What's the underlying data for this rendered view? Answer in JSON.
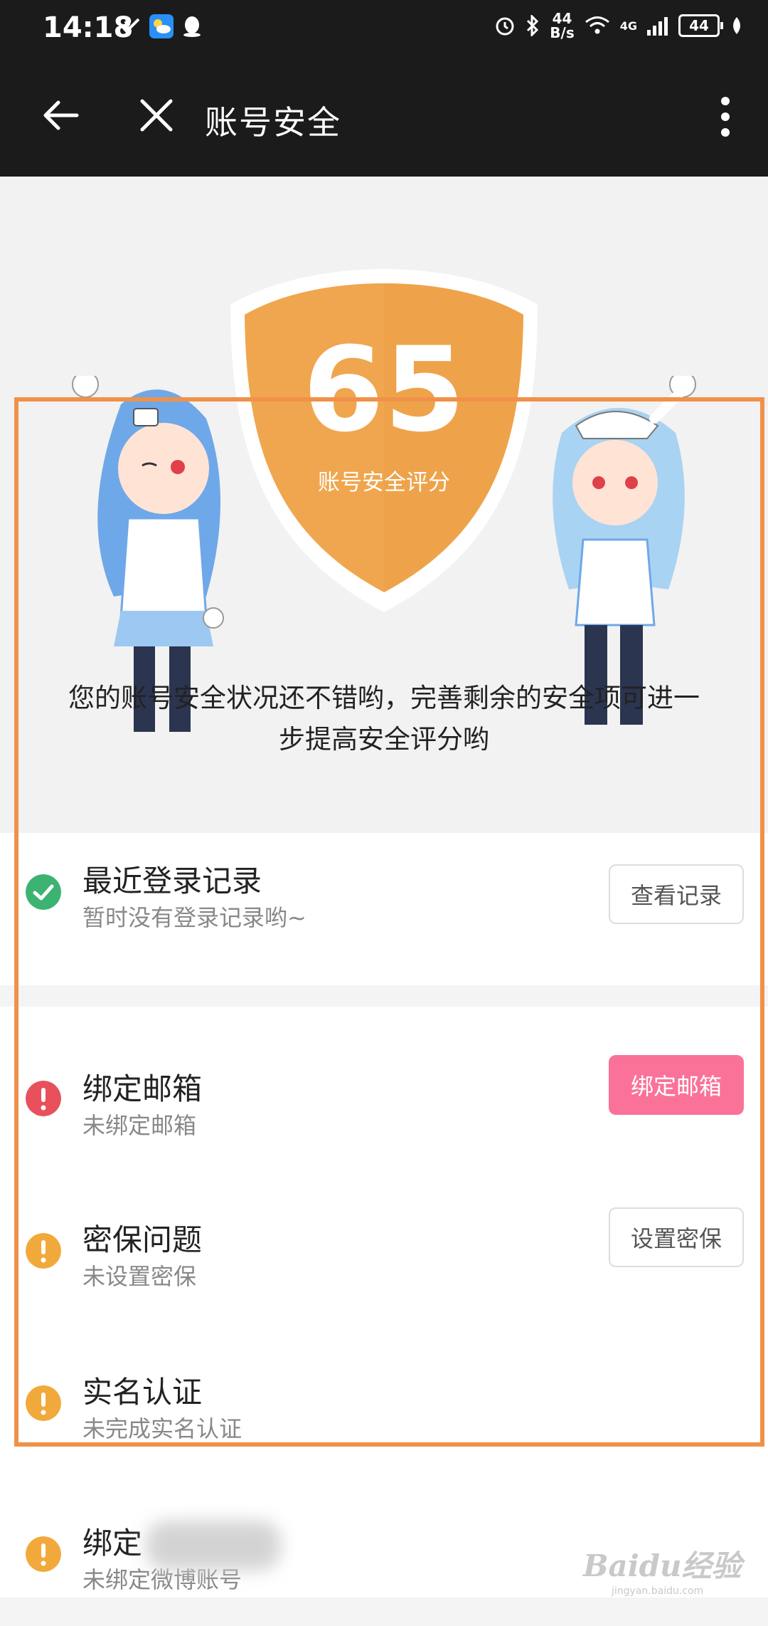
{
  "status_bar": {
    "time": "14:18",
    "net_speed_value": "44",
    "net_speed_unit": "B/s",
    "network_type": "4G",
    "battery": "44"
  },
  "app_bar": {
    "title": "账号安全"
  },
  "hero": {
    "score": "65",
    "score_label": "账号安全评分",
    "description": "您的账号安全状况还不错哟，完善剩余的安全项可进一步提高安全评分哟",
    "shield_color": "#f0a64e"
  },
  "items": [
    {
      "title": "最近登录记录",
      "subtitle": "暂时没有登录记录哟~",
      "status": "ok",
      "button": "查看记录"
    },
    {
      "title": "绑定邮箱",
      "subtitle": "未绑定邮箱",
      "status": "error",
      "button": "绑定邮箱"
    },
    {
      "title": "密保问题",
      "subtitle": "未设置密保",
      "status": "warning",
      "button": "设置密保"
    },
    {
      "title": "实名认证",
      "subtitle": "未完成实名认证",
      "status": "warning",
      "button": ""
    },
    {
      "title": "绑定",
      "subtitle": "未绑定微博账号",
      "status": "warning",
      "button": ""
    }
  ],
  "colors": {
    "ok": "#3cb371",
    "error": "#e8505b",
    "warning": "#f2a93b",
    "accent": "#fb7299",
    "highlight_frame": "#f0914a"
  },
  "watermark": {
    "brand": "Baidu经验",
    "site": "jingyan.baidu.com"
  }
}
